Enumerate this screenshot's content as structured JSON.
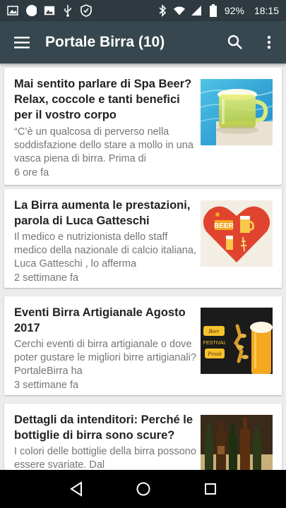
{
  "status": {
    "battery": "92%",
    "time": "18:15"
  },
  "app_bar": {
    "title": "Portale Birra (10)"
  },
  "articles": [
    {
      "title": "Mai sentito parlare di Spa Beer? Relax, coccole e tanti benefici per il vostro corpo",
      "excerpt": "“C’è un qualcosa di perverso nella soddisfazione dello stare a mollo in una vasca piena di birra. Prima di",
      "time": "6 ore fa"
    },
    {
      "title": "La Birra aumenta le prestazioni, parola di Luca Gatteschi",
      "excerpt": "Il medico e nutrizionista dello staff medico della nazionale di calcio italiana, Luca Gatteschi , lo afferma",
      "time": "2 settimane fa",
      "thumb_text": "BEER"
    },
    {
      "title": "Eventi Birra Artigianale Agosto 2017",
      "excerpt": "Cerchi eventi di birra artigianale o dove poter gustare le migliori birre artigianali? PortaleBirra ha",
      "time": "3 settimane fa",
      "thumb_text_1": "Beer",
      "thumb_text_2": "FESTIVAL",
      "thumb_text_3": "Prosit"
    },
    {
      "title": "Dettagli da intenditori: Perché le bottiglie di birra sono scure?",
      "excerpt": "  I colori delle bottiglie della birra possono essere svariate. Dal",
      "time": ""
    }
  ],
  "colors": {
    "status_bar": "#2e3a40",
    "app_bar": "#37474f",
    "background": "#ececec",
    "card": "#ffffff",
    "muted_text": "#757575"
  }
}
